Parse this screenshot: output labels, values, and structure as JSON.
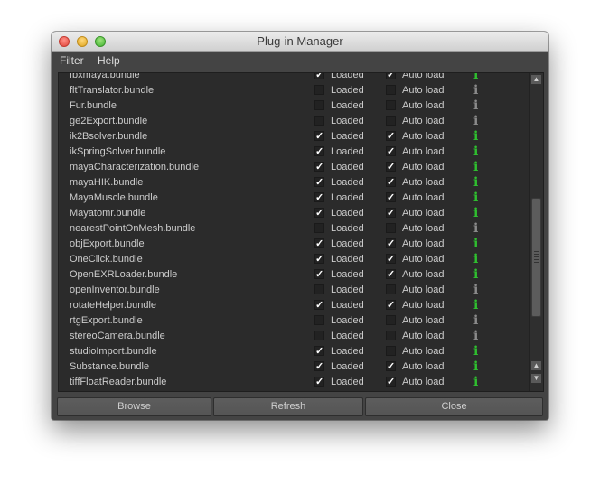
{
  "window": {
    "title": "Plug-in Manager"
  },
  "menu": {
    "filter": "Filter",
    "help": "Help"
  },
  "labels": {
    "loaded": "Loaded",
    "auto_load": "Auto load",
    "info": "i"
  },
  "colors": {
    "info_loaded": "#2fbf2f",
    "info_unloaded": "#8a8a8a"
  },
  "plugins": [
    {
      "name": "fbxmaya.bundle",
      "loaded": true,
      "auto": true
    },
    {
      "name": "fltTranslator.bundle",
      "loaded": false,
      "auto": false
    },
    {
      "name": "Fur.bundle",
      "loaded": false,
      "auto": false
    },
    {
      "name": "ge2Export.bundle",
      "loaded": false,
      "auto": false
    },
    {
      "name": "ik2Bsolver.bundle",
      "loaded": true,
      "auto": true
    },
    {
      "name": "ikSpringSolver.bundle",
      "loaded": true,
      "auto": true
    },
    {
      "name": "mayaCharacterization.bundle",
      "loaded": true,
      "auto": true
    },
    {
      "name": "mayaHIK.bundle",
      "loaded": true,
      "auto": true
    },
    {
      "name": "MayaMuscle.bundle",
      "loaded": true,
      "auto": true
    },
    {
      "name": "Mayatomr.bundle",
      "loaded": true,
      "auto": true
    },
    {
      "name": "nearestPointOnMesh.bundle",
      "loaded": false,
      "auto": false
    },
    {
      "name": "objExport.bundle",
      "loaded": true,
      "auto": true
    },
    {
      "name": "OneClick.bundle",
      "loaded": true,
      "auto": true
    },
    {
      "name": "OpenEXRLoader.bundle",
      "loaded": true,
      "auto": true
    },
    {
      "name": "openInventor.bundle",
      "loaded": false,
      "auto": false
    },
    {
      "name": "rotateHelper.bundle",
      "loaded": true,
      "auto": true
    },
    {
      "name": "rtgExport.bundle",
      "loaded": false,
      "auto": false
    },
    {
      "name": "stereoCamera.bundle",
      "loaded": false,
      "auto": false
    },
    {
      "name": "studioImport.bundle",
      "loaded": true,
      "auto": false
    },
    {
      "name": "Substance.bundle",
      "loaded": true,
      "auto": true
    },
    {
      "name": "tiffFloatReader.bundle",
      "loaded": true,
      "auto": true
    }
  ],
  "scrollbar": {
    "position": 0.75
  },
  "buttons": {
    "browse": "Browse",
    "refresh": "Refresh",
    "close": "Close"
  }
}
